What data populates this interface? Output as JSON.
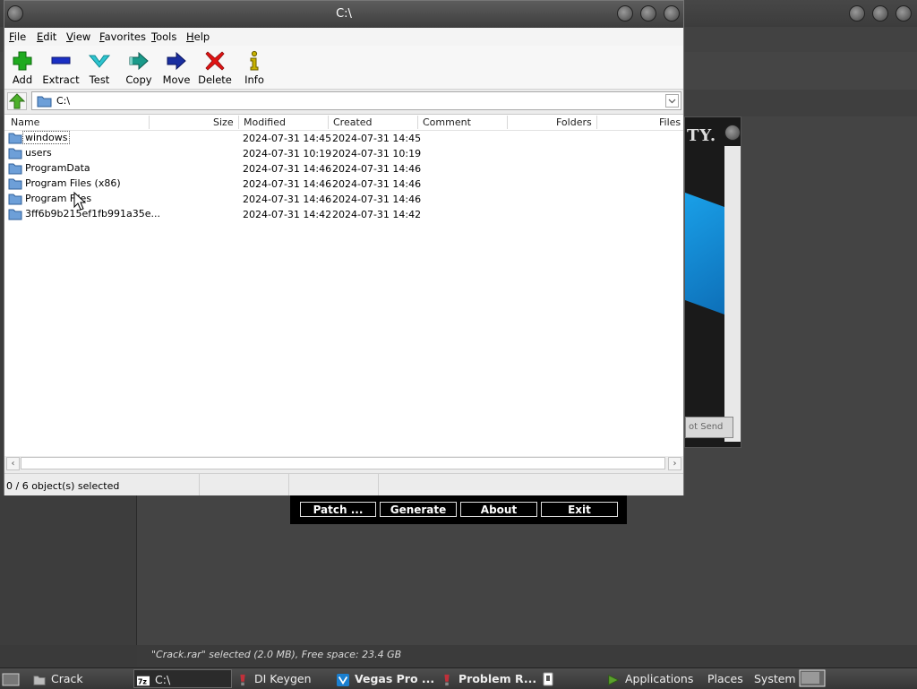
{
  "window": {
    "title": "C:\\"
  },
  "menubar": {
    "items": [
      {
        "label": "File",
        "key": "F",
        "rest": "ile"
      },
      {
        "label": "Edit",
        "key": "E",
        "rest": "dit"
      },
      {
        "label": "View",
        "key": "V",
        "rest": "iew"
      },
      {
        "label": "Favorites",
        "key": "F",
        "rest": "avorites"
      },
      {
        "label": "Tools",
        "key": "T",
        "rest": "ools"
      },
      {
        "label": "Help",
        "key": "H",
        "rest": "elp"
      }
    ]
  },
  "toolbar": {
    "add": "Add",
    "extract": "Extract",
    "test": "Test",
    "copy": "Copy",
    "move": "Move",
    "delete": "Delete",
    "info": "Info",
    "colors": {
      "add": "#1faa1f",
      "extract": "#1a2fc4",
      "test": "#2ec4cf",
      "copy": "#1a9a8a",
      "move": "#1a2fa0",
      "delete": "#e01414",
      "info": "#c8b200"
    }
  },
  "address": {
    "path": "C:\\"
  },
  "columns": {
    "name": "Name",
    "size": "Size",
    "modified": "Modified",
    "created": "Created",
    "comment": "Comment",
    "folders": "Folders",
    "files": "Files"
  },
  "files": [
    {
      "name": "windows",
      "modified": "2024-07-31 14:45",
      "created": "2024-07-31 14:45"
    },
    {
      "name": "users",
      "modified": "2024-07-31 10:19",
      "created": "2024-07-31 10:19"
    },
    {
      "name": "ProgramData",
      "modified": "2024-07-31 14:46",
      "created": "2024-07-31 14:46"
    },
    {
      "name": "Program Files (x86)",
      "modified": "2024-07-31 14:46",
      "created": "2024-07-31 14:46"
    },
    {
      "name": "Program Files",
      "modified": "2024-07-31 14:46",
      "created": "2024-07-31 14:46"
    },
    {
      "name": "3ff6b9b215ef1fb991a35e...",
      "modified": "2024-07-31 14:42",
      "created": "2024-07-31 14:42"
    }
  ],
  "statusbar": {
    "selection": "0 / 6 object(s) selected"
  },
  "keygen": {
    "brand": "TY.",
    "buttons": [
      "Patch ...",
      "Generate",
      "About",
      "Exit"
    ],
    "partial_button": "ot Send"
  },
  "filemanager_status": "\"Crack.rar\" selected (2.0 MB), Free space: 23.4 GB",
  "taskbar": {
    "tasks": [
      "Crack",
      "C:\\",
      "DI Keygen",
      "Vegas Pro ...",
      "Problem R..."
    ],
    "menus": [
      "Applications",
      "Places",
      "System"
    ]
  }
}
